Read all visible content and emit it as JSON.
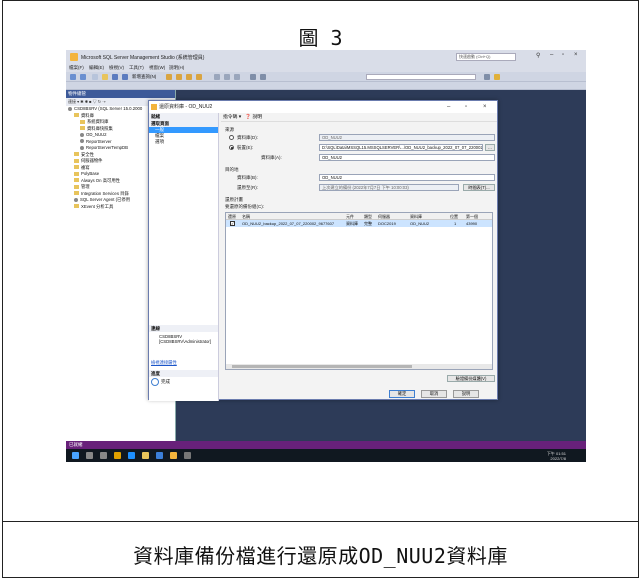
{
  "figure": {
    "title": "圖 3",
    "caption": "資料庫備份檔進行還原成OD_NUU2資料庫"
  },
  "ssms": {
    "window_title": "Microsoft SQL Server Management Studio (系統管理員)",
    "quick_launch_placeholder": "快速啟動 (Ctrl+Q)",
    "menu": [
      "檔案(F)",
      "編輯(E)",
      "檢視(V)",
      "工具(T)",
      "視窗(W)",
      "說明(H)"
    ],
    "new_query_label": "新增查詢(N)",
    "explorer": {
      "header": "物件總管",
      "toolbar": "連接 ▾ ✱ ✱ ■ ▽ ↻ ⇢",
      "items": [
        "CSD8BSRV (SQL Server 15.0.2000",
        "資料庫",
        "系統資料庫",
        "資料庫快照集",
        "OD_NUU2",
        "ReportServer",
        "ReportServerTempDB",
        "安全性",
        "伺服器物件",
        "複寫",
        "PolyBase",
        "Always On 高可用性",
        "管理",
        "Integration Services 目錄",
        "SQL Server Agent (已停用",
        "XEvent 分析工具"
      ]
    },
    "status_text": "已就緒",
    "tray_time": "下午 01:51",
    "tray_date": "2022/7/8"
  },
  "dialog": {
    "title": "還原資料庫 - OD_NUU2",
    "ready_header": "就緒",
    "pages_header": "選取頁面",
    "pages": [
      "一般",
      "檔案",
      "選項"
    ],
    "connection_header": "連線",
    "connection_server": "CSD8BSRV",
    "connection_user": "[CSD8BSRV\\Administrator]",
    "connection_link": "檢視連接屬性",
    "progress_header": "進度",
    "progress_status": "完成",
    "script_label": "指令碼",
    "help_label": "說明",
    "source_label": "來源",
    "source_db_label": "資料庫(D):",
    "source_db_value": "OD_NUU2",
    "device_label": "裝置(E):",
    "device_path": "D:\\SQL\\Data\\MSSQL15.MSSQLSERVER\\...\\OD_NUU2_backup_2022_07_07_220002_9677607.bak",
    "device_db_label": "資料庫(A):",
    "device_db_value": "OD_NUU2",
    "destination_label": "目的地",
    "dest_db_label": "資料庫(B):",
    "dest_db_value": "OD_NUU2",
    "restore_to_label": "還原至(R):",
    "restore_to_value": "上次建立的備份 (2022年7月7日 下午 10:00:03)",
    "timeline_button": "時間表(T)...",
    "restore_plan_label": "還原計畫",
    "backupsets_label": "要還原的備份組(C):",
    "grid_headers": [
      "還原",
      "名稱",
      "元件",
      "類型",
      "伺服器",
      "資料庫",
      "位置",
      "第一個"
    ],
    "grid_row": [
      "✓",
      "OD_NUU2_backup_2022_07_07_220002_9677607",
      "資料庫",
      "完整",
      "DOC2019",
      "OD_NUU2",
      "1",
      "43990"
    ],
    "verify_button": "驗證備份媒體(V)",
    "ok_button": "確定",
    "cancel_button": "取消",
    "help_button": "說明"
  }
}
